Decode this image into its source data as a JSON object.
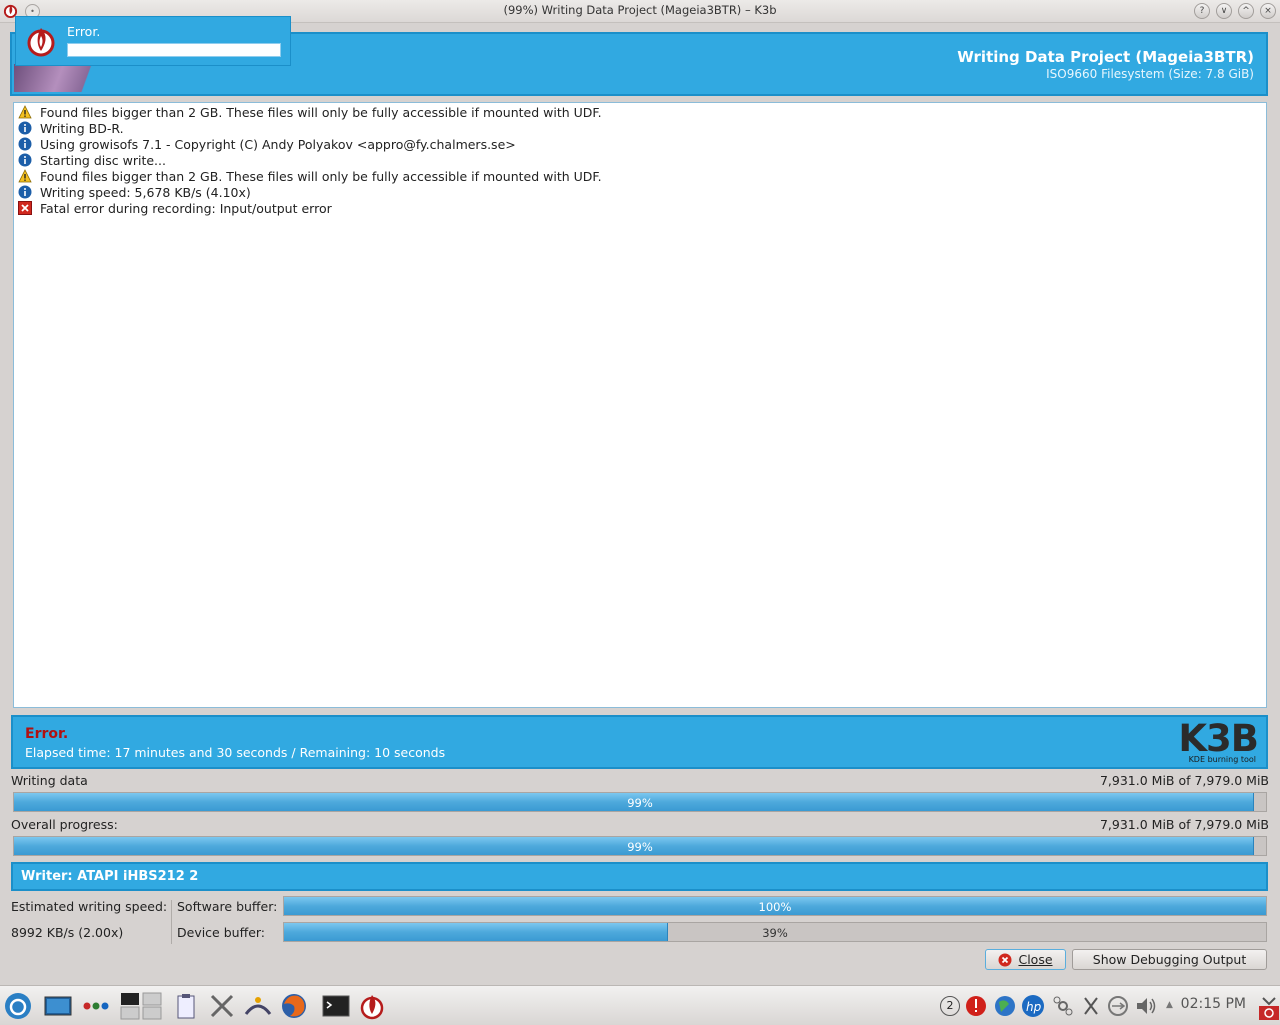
{
  "window": {
    "title": "(99%) Writing Data Project (Mageia3BTR) – K3b",
    "buttons": [
      "?",
      "∨",
      "^",
      "×"
    ]
  },
  "popup": {
    "label": "Error."
  },
  "header": {
    "title": "Writing Data Project (Mageia3BTR)",
    "subtitle": "ISO9660 Filesystem (Size: 7.8 GiB)"
  },
  "log": [
    {
      "type": "warning",
      "text": "Found files bigger than 2 GB. These files will only be fully accessible if mounted with UDF."
    },
    {
      "type": "info",
      "text": "Writing BD-R."
    },
    {
      "type": "info",
      "text": "Using growisofs 7.1 - Copyright (C) Andy Polyakov <appro@fy.chalmers.se>"
    },
    {
      "type": "info",
      "text": "Starting disc write..."
    },
    {
      "type": "warning",
      "text": "Found files bigger than 2 GB. These files will only be fully accessible if mounted with UDF."
    },
    {
      "type": "info",
      "text": "Writing speed: 5,678 KB/s (4.10x)"
    },
    {
      "type": "error",
      "text": "Fatal error during recording: Input/output error"
    }
  ],
  "status": {
    "state": "Error.",
    "elapsed": "Elapsed time: 17 minutes and 30 seconds / Remaining: 10 seconds",
    "logo_text": "K3B",
    "logo_sub": "KDE burning tool"
  },
  "writing_data": {
    "label": "Writing data",
    "amount": "7,931.0 MiB of 7,979.0 MiB",
    "percent": 99,
    "percent_text": "99%"
  },
  "overall": {
    "label": "Overall progress:",
    "amount": "7,931.0 MiB of 7,979.0 MiB",
    "percent": 99,
    "percent_text": "99%"
  },
  "writer": {
    "label": "Writer: ATAPI iHBS212   2"
  },
  "speed": {
    "label": "Estimated writing speed:",
    "value": "8992 KB/s (2.00x)"
  },
  "software_buffer": {
    "label": "Software buffer:",
    "percent": 100,
    "percent_text": "100%"
  },
  "device_buffer": {
    "label": "Device buffer:",
    "percent": 39,
    "percent_text": "39%"
  },
  "buttons": {
    "close": "Close",
    "debug": "Show Debugging Output"
  },
  "taskbar": {
    "clock": "02:15 PM",
    "desktop_count": "2",
    "icons": [
      "mageia-menu-icon",
      "desktop-icon",
      "dots-icon",
      "pager-icon",
      "clipboard-icon",
      "tools-icon",
      "network-icon",
      "firefox-icon",
      "terminal-icon",
      "k3b-icon"
    ]
  },
  "colors": {
    "accent": "#31a9e1",
    "accent_border": "#1b8fc9",
    "error": "#b01010"
  }
}
